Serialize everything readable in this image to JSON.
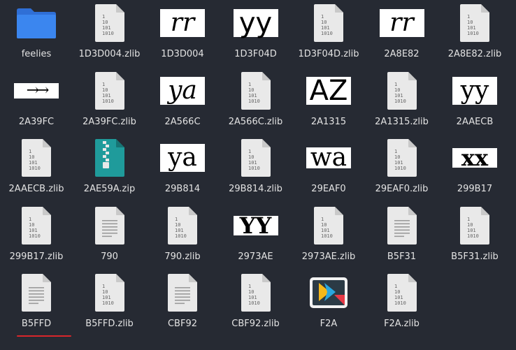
{
  "files": [
    {
      "label": "feelies",
      "kind": "folder"
    },
    {
      "label": "1D3D004.zlib",
      "kind": "binary",
      "binary_text": [
        "1",
        "10",
        "101",
        "1010"
      ]
    },
    {
      "label": "1D3D004",
      "kind": "glyph",
      "glyph": "rr",
      "style": "italic"
    },
    {
      "label": "1D3F04D",
      "kind": "glyph",
      "glyph": "yy",
      "style": "sans"
    },
    {
      "label": "1D3F04D.zlib",
      "kind": "binary",
      "binary_text": [
        "1",
        "10",
        "101",
        "1010"
      ]
    },
    {
      "label": "2A8E82",
      "kind": "glyph",
      "glyph": "rr",
      "style": "italic"
    },
    {
      "label": "2A8E82.zlib",
      "kind": "binary",
      "binary_text": [
        "1",
        "10",
        "101",
        "1010"
      ]
    },
    {
      "label": "2A39FC",
      "kind": "glyph",
      "glyph": "→→",
      "style": "arrow"
    },
    {
      "label": "2A39FC.zlib",
      "kind": "binary",
      "binary_text": [
        "1",
        "10",
        "101",
        "1010"
      ]
    },
    {
      "label": "2A566C",
      "kind": "glyph",
      "glyph": "ya",
      "style": "italic"
    },
    {
      "label": "2A566C.zlib",
      "kind": "binary",
      "binary_text": [
        "1",
        "10",
        "101",
        "1010"
      ]
    },
    {
      "label": "2A1315",
      "kind": "glyph",
      "glyph": "AZ",
      "style": "sans"
    },
    {
      "label": "2A1315.zlib",
      "kind": "binary",
      "binary_text": [
        "1",
        "10",
        "101",
        "1010"
      ]
    },
    {
      "label": "2AAECB",
      "kind": "glyph",
      "glyph": "yy",
      "style": "serif"
    },
    {
      "label": "2AAECB.zlib",
      "kind": "binary",
      "binary_text": [
        "1",
        "10",
        "101",
        "1010"
      ]
    },
    {
      "label": "2AE59A.zip",
      "kind": "zip"
    },
    {
      "label": "29B814",
      "kind": "glyph",
      "glyph": "ya",
      "style": "serif"
    },
    {
      "label": "29B814.zlib",
      "kind": "binary",
      "binary_text": [
        "1",
        "10",
        "101",
        "1010"
      ]
    },
    {
      "label": "29EAF0",
      "kind": "glyph",
      "glyph": "wa",
      "style": "serif"
    },
    {
      "label": "29EAF0.zlib",
      "kind": "binary",
      "binary_text": [
        "1",
        "10",
        "101",
        "1010"
      ]
    },
    {
      "label": "299B17",
      "kind": "glyph",
      "glyph": "xx",
      "style": "bold"
    },
    {
      "label": "299B17.zlib",
      "kind": "binary",
      "binary_text": [
        "1",
        "10",
        "101",
        "1010"
      ]
    },
    {
      "label": "790",
      "kind": "text"
    },
    {
      "label": "790.zlib",
      "kind": "binary",
      "binary_text": [
        "1",
        "10",
        "101",
        "1010"
      ]
    },
    {
      "label": "2973AE",
      "kind": "glyph",
      "glyph": "YY",
      "style": "bold"
    },
    {
      "label": "2973AE.zlib",
      "kind": "binary",
      "binary_text": [
        "1",
        "10",
        "101",
        "1010"
      ]
    },
    {
      "label": "B5F31",
      "kind": "text"
    },
    {
      "label": "B5F31.zlib",
      "kind": "binary",
      "binary_text": [
        "1",
        "10",
        "101",
        "1010"
      ]
    },
    {
      "label": "B5FFD",
      "kind": "text",
      "selected": true
    },
    {
      "label": "B5FFD.zlib",
      "kind": "binary",
      "binary_text": [
        "1",
        "10",
        "101",
        "1010"
      ]
    },
    {
      "label": "CBF92",
      "kind": "text"
    },
    {
      "label": "CBF92.zlib",
      "kind": "binary",
      "binary_text": [
        "1",
        "10",
        "101",
        "1010"
      ]
    },
    {
      "label": "F2A",
      "kind": "app"
    },
    {
      "label": "F2A.zlib",
      "kind": "binary",
      "binary_text": [
        "1",
        "10",
        "101",
        "1010"
      ]
    }
  ],
  "colors": {
    "background": "#262a33",
    "folder": "#3b7ddd",
    "zip": "#1f9b9b",
    "selection": "#d9262b"
  }
}
